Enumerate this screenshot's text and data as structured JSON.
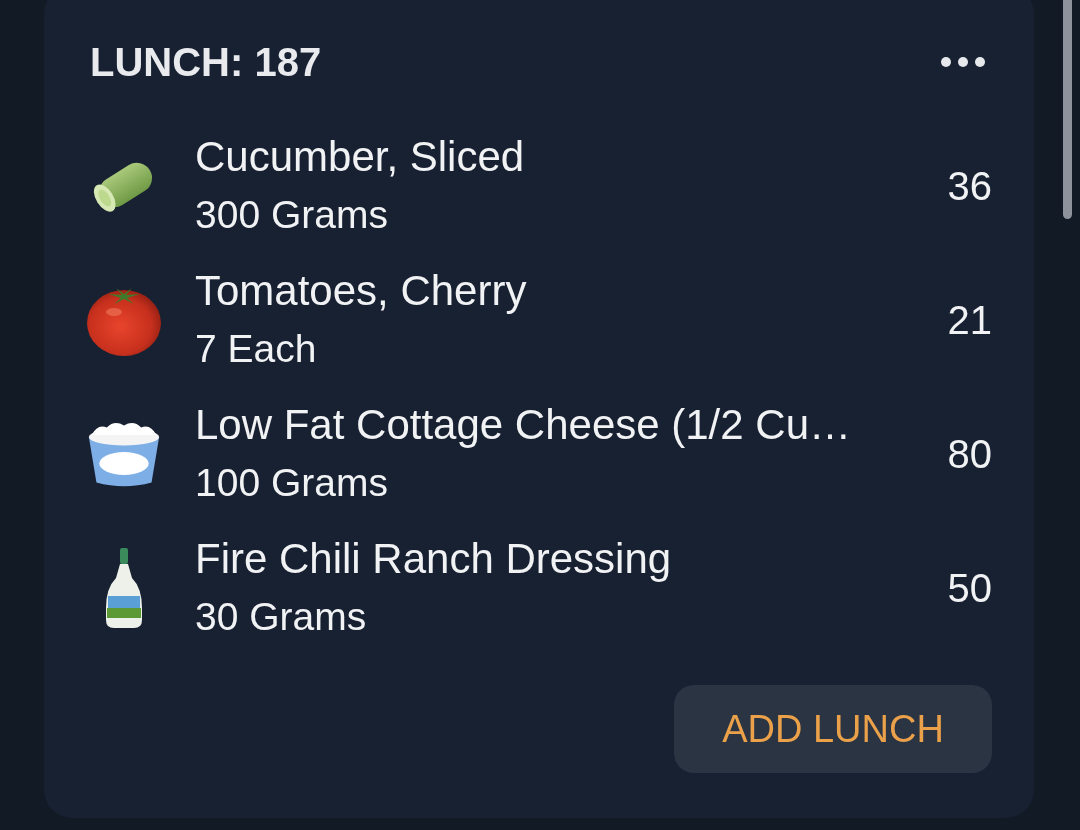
{
  "meal": {
    "title": "LUNCH: 187",
    "items": [
      {
        "kind": "cucumber",
        "name": "Cucumber, Sliced",
        "amount": "300 Grams",
        "calories": "36"
      },
      {
        "kind": "tomato",
        "name": "Tomatoes, Cherry",
        "amount": "7 Each",
        "calories": "21"
      },
      {
        "kind": "tub",
        "name": "Low Fat Cottage Cheese (1/2 Cu…",
        "amount": "100 Grams",
        "calories": "80"
      },
      {
        "kind": "bottle",
        "name": "Fire Chili Ranch Dressing",
        "amount": "30 Grams",
        "calories": "50"
      }
    ],
    "add_button": "ADD LUNCH"
  }
}
